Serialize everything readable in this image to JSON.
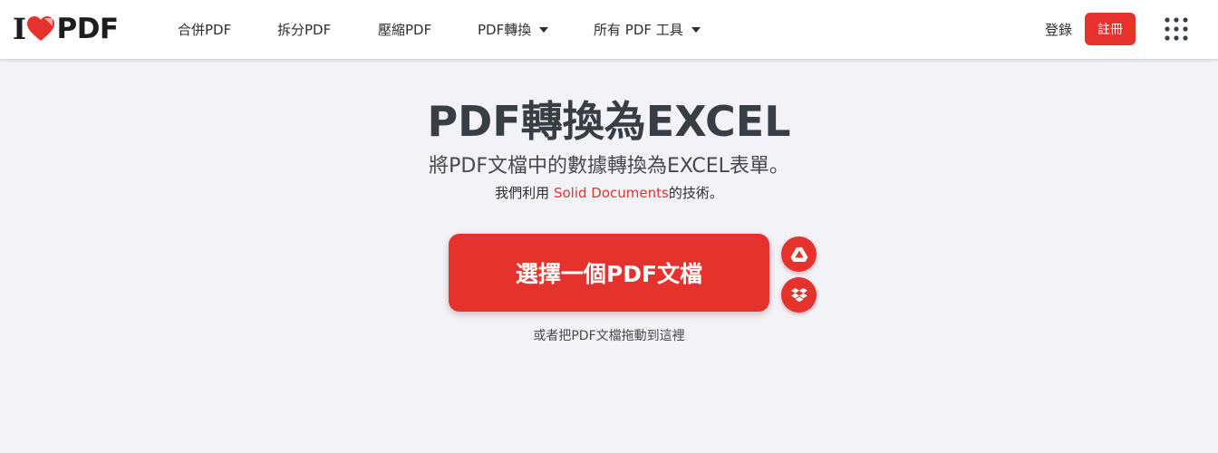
{
  "header": {
    "logo": {
      "prefix": "I",
      "suffix": "PDF"
    },
    "nav": [
      {
        "label": "合併PDF"
      },
      {
        "label": "拆分PDF"
      },
      {
        "label": "壓縮PDF"
      },
      {
        "label": "PDF轉換",
        "dropdown": true
      },
      {
        "label": "所有 PDF 工具",
        "dropdown": true
      }
    ],
    "login_label": "登錄",
    "signup_label": "註冊",
    "apps_icon": "grid-dots-icon"
  },
  "main": {
    "title": "PDF轉換為EXCEL",
    "subtitle": "將PDF文檔中的數據轉換為EXCEL表單。",
    "credit_prefix": "我們利用 ",
    "credit_link": "Solid Documents",
    "credit_suffix": "的技術。",
    "select_button_label": "選擇一個PDF文檔",
    "cloud_icons": [
      "google-drive-icon",
      "dropbox-icon"
    ],
    "drop_hint": "或者把PDF文檔拖動到這裡"
  },
  "colors": {
    "brand_red": "#e5322d",
    "background": "#f3f2f7",
    "header_bg": "#ffffff",
    "text_dark": "#383e45"
  }
}
